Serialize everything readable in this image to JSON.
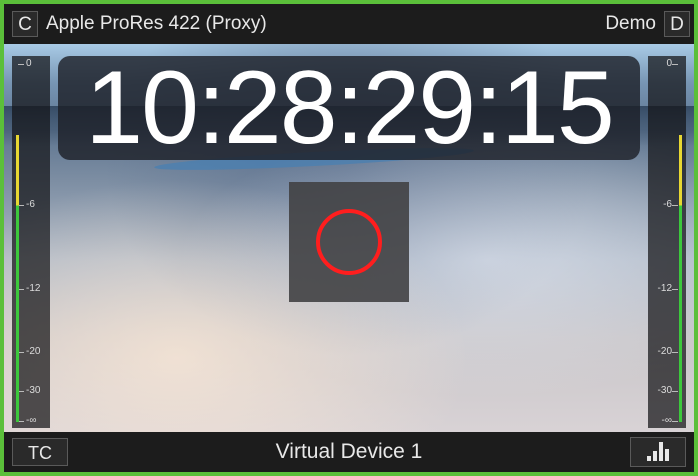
{
  "top_bar": {
    "left_tag": "C",
    "codec": "Apple ProRes 422 (Proxy)",
    "mode": "Demo",
    "right_tag": "D"
  },
  "video": {
    "timecode": "10:28:29:15"
  },
  "audio_meters": {
    "scale_labels": [
      "0",
      "-6",
      "-12",
      "-20",
      "-30",
      "-∞"
    ],
    "left_level_db": -3,
    "right_level_db": -3,
    "meter_color": "#3cc83c",
    "peak_color": "#e8d832"
  },
  "bottom_bar": {
    "tc_label": "TC",
    "device_name": "Virtual Device 1",
    "meters_icon": "audio-meter-bars-icon"
  },
  "colors": {
    "frame_border": "#5bbf3a",
    "record_ring": "#ff1e1e"
  }
}
